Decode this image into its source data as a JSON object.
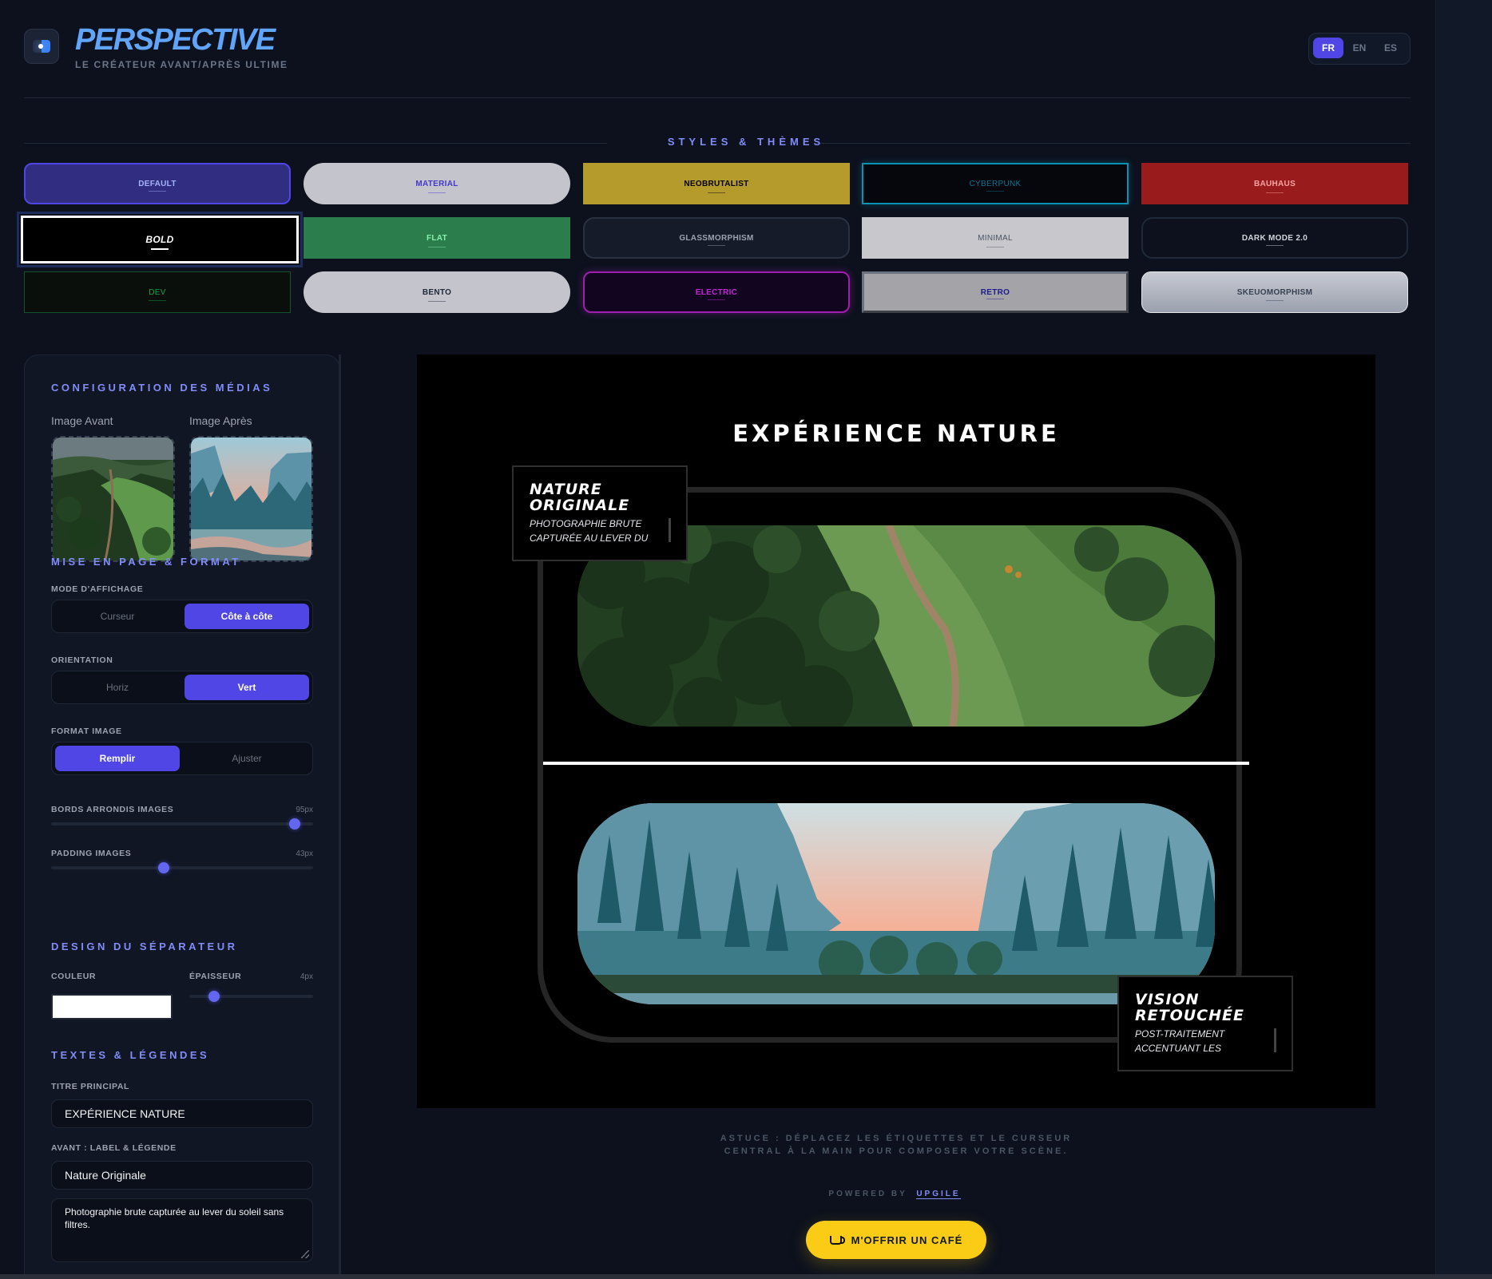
{
  "header": {
    "brand": "PERSPECTIVE",
    "tagline": "LE CRÉATEUR AVANT/APRÈS ULTIME",
    "languages": [
      {
        "code": "FR",
        "active": true
      },
      {
        "code": "EN",
        "active": false
      },
      {
        "code": "ES",
        "active": false
      }
    ]
  },
  "themes": {
    "title": "STYLES & THÈMES",
    "items": [
      {
        "label": "DEFAULT"
      },
      {
        "label": "MATERIAL"
      },
      {
        "label": "NEOBRUTALIST"
      },
      {
        "label": "CYBERPUNK"
      },
      {
        "label": "BAUHAUS"
      },
      {
        "label": "BOLD"
      },
      {
        "label": "FLAT"
      },
      {
        "label": "GLASSMORPHISM"
      },
      {
        "label": "MINIMAL"
      },
      {
        "label": "DARK MODE 2.0"
      },
      {
        "label": "DEV"
      },
      {
        "label": "BENTO"
      },
      {
        "label": "ELECTRIC"
      },
      {
        "label": "RETRO"
      },
      {
        "label": "SKEUOMORPHISM"
      }
    ],
    "selected": "BOLD"
  },
  "panel": {
    "media": {
      "title": "CONFIGURATION DES MÉDIAS",
      "before_label": "Image Avant",
      "after_label": "Image Après"
    },
    "layout": {
      "title": "MISE EN PAGE & FORMAT",
      "display_mode": {
        "label": "MODE D'AFFICHAGE",
        "options": [
          "Curseur",
          "Côte à côte"
        ],
        "selected": "Côte à côte"
      },
      "orientation": {
        "label": "ORIENTATION",
        "options": [
          "Horiz",
          "Vert"
        ],
        "selected": "Vert"
      },
      "image_format": {
        "label": "FORMAT IMAGE",
        "options": [
          "Remplir",
          "Ajuster"
        ],
        "selected": "Remplir"
      },
      "radius": {
        "label": "BORDS ARRONDIS IMAGES",
        "value": "95px",
        "fraction": 0.93
      },
      "padding": {
        "label": "PADDING IMAGES",
        "value": "43px",
        "fraction": 0.43
      }
    },
    "separator": {
      "title": "DESIGN DU SÉPARATEUR",
      "color_label": "COULEUR",
      "color_value": "#ffffff",
      "thickness_label": "ÉPAISSEUR",
      "thickness_value": "4px",
      "thickness_fraction": 0.2
    },
    "texts": {
      "title": "TEXTES & LÉGENDES",
      "main_title_label": "TITRE PRINCIPAL",
      "main_title_value": "EXPÉRIENCE NATURE",
      "before_label": "AVANT : LABEL & LÉGENDE",
      "before_title_value": "Nature Originale",
      "before_caption_value": "Photographie brute capturée au lever du soleil sans filtres."
    }
  },
  "preview": {
    "title": "EXPÉRIENCE NATURE",
    "before": {
      "title_line1": "NATURE",
      "title_line2": "ORIGINALE",
      "sub_line1": "PHOTOGRAPHIE BRUTE",
      "sub_line2": "CAPTURÉE AU LEVER DU"
    },
    "after": {
      "title_line1": "VISION",
      "title_line2": "RETOUCHÉE",
      "sub_line1": "POST-TRAITEMENT",
      "sub_line2": "ACCENTUANT LES"
    }
  },
  "footer": {
    "hint": "ASTUCE : DÉPLACEZ LES ÉTIQUETTES ET LE CURSEUR CENTRAL À LA MAIN POUR COMPOSER VOTRE SCÈNE.",
    "powered_prefix": "POWERED BY",
    "powered_link": "UPGILE",
    "coffee_label": "M'OFFRIR UN CAFÉ"
  },
  "colors": {
    "accent": "#4f46e5",
    "accent_light": "#818cf8",
    "coffee": "#facc15",
    "background": "#0c111d"
  }
}
